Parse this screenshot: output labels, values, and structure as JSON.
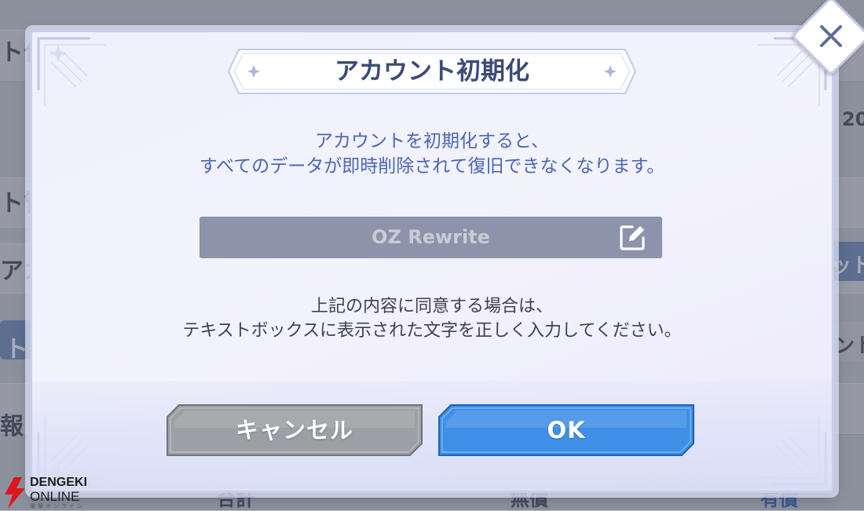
{
  "background": {
    "fragments": [
      {
        "id": "frag-top-left",
        "text": "ト化"
      },
      {
        "id": "frag-mid-left",
        "text": "ト管"
      },
      {
        "id": "frag-acct-left",
        "text": "アカ"
      },
      {
        "id": "frag-blue-left",
        "text": "ト"
      },
      {
        "id": "frag-info-left",
        "text": "報"
      },
      {
        "id": "frag-year-right",
        "text": "20"
      },
      {
        "id": "frag-right-1",
        "text": "ット"
      },
      {
        "id": "frag-right-2",
        "text": "ント"
      },
      {
        "id": "frag-bottom-1",
        "text": "合計"
      },
      {
        "id": "frag-bottom-2",
        "text": "無償"
      },
      {
        "id": "frag-bottom-3",
        "text": "有償"
      }
    ]
  },
  "dialog": {
    "title": "アカウント初期化",
    "message_lines": [
      "アカウントを初期化すると、",
      "すべてのデータが即時削除されて復旧できなくなります。"
    ],
    "name_field": {
      "value": "OZ Rewrite",
      "icon": "edit-icon"
    },
    "instruction_lines": [
      "上記の内容に同意する場合は、",
      "テキストボックスに表示された文字を正しく入力してください。"
    ],
    "cancel_label": "キャンセル",
    "ok_label": "OK",
    "close_icon": "close-icon"
  },
  "watermark": {
    "line1": "DENGEKI",
    "line2": "ONLINE",
    "line3": "電撃オンライン"
  },
  "colors": {
    "title_text": "#3b4b78",
    "message_text": "#4a66b7",
    "field_bg": "#8c93aa",
    "cancel_bg": "#9a9c9f",
    "ok_bg": "#3e8fe6"
  }
}
